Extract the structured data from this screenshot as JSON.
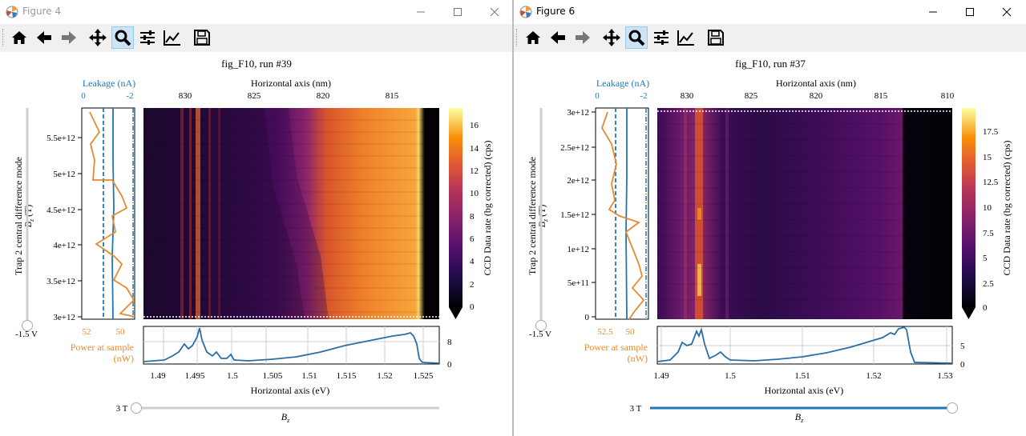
{
  "colors": {
    "leakage": "#1f77b4",
    "power": "#e8892e",
    "spectrum": "#2a6ea6",
    "slider": "#1f77b4"
  },
  "toolbar_icons": [
    "home-icon",
    "back-icon",
    "forward-icon",
    "pan-icon",
    "zoom-icon",
    "configure-icon",
    "edit-axis-icon",
    "save-icon"
  ],
  "windows": [
    {
      "title": "Figure 4",
      "fig_title": "fig_F10, run #39",
      "top_axis_label": "Horizontal axis (nm)",
      "top_ticks": [
        "830",
        "825",
        "820",
        "815"
      ],
      "leakage_label": "Leakage (nA)",
      "leakage_ticks": [
        "0",
        "-2"
      ],
      "y_label_1": "Trap 2 central difference mode",
      "y_label_2": "B",
      "y_label_sub": "z",
      "y_label_unit": " (T)",
      "y_ticks": [
        "5.5e+12",
        "5e+12",
        "4.5e+12",
        "4e+12",
        "3.5e+12",
        "3e+12"
      ],
      "power_ticks": [
        "52",
        "50"
      ],
      "power_label_1": "Power at sample",
      "power_label_2": "(nW)",
      "colorbar_label": "CCD Data rate (bg corrected) (cps)",
      "colorbar_ticks": [
        "16",
        "14",
        "12",
        "10",
        "8",
        "6",
        "4",
        "2",
        "0"
      ],
      "spectrum_ticks": [
        "8",
        "0"
      ],
      "bottom_ticks": [
        "1.49",
        "1.495",
        "1.5",
        "1.505",
        "1.51",
        "1.515",
        "1.52",
        "1.525"
      ],
      "bottom_axis_label": "Horizontal axis (eV)",
      "vslider_label": "-1.5 V",
      "hslider_label": "3 T",
      "hslider_name": "B",
      "hslider_sub": "z",
      "hslider_value": 0.0
    },
    {
      "title": "Figure 6",
      "fig_title": "fig_F10, run #37",
      "top_axis_label": "Horizontal axis (nm)",
      "top_ticks": [
        "830",
        "825",
        "820",
        "815",
        "810"
      ],
      "leakage_label": "Leakage (nA)",
      "leakage_ticks": [
        "0",
        "-2"
      ],
      "y_label_1": "Trap 2 central difference mode",
      "y_label_2": "B",
      "y_label_sub": "z",
      "y_label_unit": " (T)",
      "y_ticks": [
        "3e+12",
        "2.5e+12",
        "2e+12",
        "1.5e+12",
        "1e+12",
        "5e+11",
        "0"
      ],
      "power_ticks": [
        "52.5",
        "50"
      ],
      "power_label_1": "Power at sample",
      "power_label_2": "(nW)",
      "colorbar_label": "CCD Data rate (bg corrected) (cps)",
      "colorbar_ticks": [
        "17.5",
        "15",
        "12.5",
        "10",
        "7.5",
        "5",
        "2.5",
        "0"
      ],
      "spectrum_ticks": [
        "5",
        "0"
      ],
      "bottom_ticks": [
        "1.49",
        "1.5",
        "1.51",
        "1.52",
        "1.53"
      ],
      "bottom_axis_label": "Horizontal axis (eV)",
      "vslider_label": "-1.5 V",
      "hslider_label": "3 T",
      "hslider_name": "B",
      "hslider_sub": "z",
      "hslider_value": 1.0
    }
  ]
}
